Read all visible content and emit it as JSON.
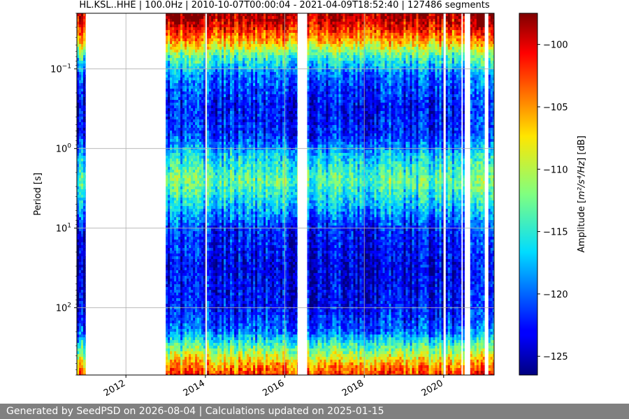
{
  "chart_data": {
    "type": "heatmap",
    "title": "HL.KSL..HHE | 100.0Hz | 2010-10-07T00:00:04 - 2021-04-09T18:52:40 | 127486 segments",
    "xlabel": "",
    "ylabel": "Period [s]",
    "yscale": "log",
    "yaxis_inverted": true,
    "ylim": [
      0.02,
      700
    ],
    "xlim": [
      "2010-10-07",
      "2021-04-09"
    ],
    "x_ticks": [
      "2012",
      "2014",
      "2016",
      "2018",
      "2020"
    ],
    "y_ticks": [
      {
        "value": 0.1,
        "base": "10",
        "exp": "−1"
      },
      {
        "value": 1,
        "base": "10",
        "exp": "0"
      },
      {
        "value": 10,
        "base": "10",
        "exp": "1"
      },
      {
        "value": 100,
        "base": "10",
        "exp": "2"
      }
    ],
    "grid": true,
    "colormap": "jet",
    "colorbar": {
      "label_prefix": "Amplitude [",
      "label_unit": "m²/s⁴/Hz",
      "label_suffix": "] [dB]",
      "range": [
        -126.5,
        -97.5
      ],
      "ticks": [
        "−100",
        "−105",
        "−110",
        "−115",
        "−120",
        "−125"
      ],
      "tick_values": [
        -100,
        -105,
        -110,
        -115,
        -120,
        -125
      ]
    },
    "data_intervals": [
      [
        "2010-10-07",
        "2010-12-25"
      ],
      [
        "2013-01-01",
        "2014-01-01"
      ],
      [
        "2014-01-15",
        "2016-04-25"
      ],
      [
        "2016-07-25",
        "2019-12-31"
      ],
      [
        "2020-01-20",
        "2020-06-10"
      ],
      [
        "2020-06-25",
        "2020-07-10"
      ],
      [
        "2020-09-01",
        "2021-01-10"
      ],
      [
        "2021-02-15",
        "2021-04-09"
      ]
    ],
    "amplitude_profile": [
      {
        "period": 0.02,
        "amplitude_db": -98
      },
      {
        "period": 0.03,
        "amplitude_db": -101
      },
      {
        "period": 0.045,
        "amplitude_db": -106
      },
      {
        "period": 0.07,
        "amplitude_db": -114
      },
      {
        "period": 0.12,
        "amplitude_db": -120
      },
      {
        "period": 0.3,
        "amplitude_db": -123
      },
      {
        "period": 0.7,
        "amplitude_db": -122
      },
      {
        "period": 1.2,
        "amplitude_db": -117
      },
      {
        "period": 2.5,
        "amplitude_db": -113
      },
      {
        "period": 5,
        "amplitude_db": -117
      },
      {
        "period": 10,
        "amplitude_db": -122
      },
      {
        "period": 30,
        "amplitude_db": -124
      },
      {
        "period": 100,
        "amplitude_db": -123
      },
      {
        "period": 200,
        "amplitude_db": -120
      },
      {
        "period": 300,
        "amplitude_db": -114
      },
      {
        "period": 500,
        "amplitude_db": -106
      },
      {
        "period": 700,
        "amplitude_db": -102
      }
    ]
  },
  "footer": {
    "text": "Generated by SeedPSD on 2026-08-04 | Calculations updated on 2025-01-15"
  }
}
